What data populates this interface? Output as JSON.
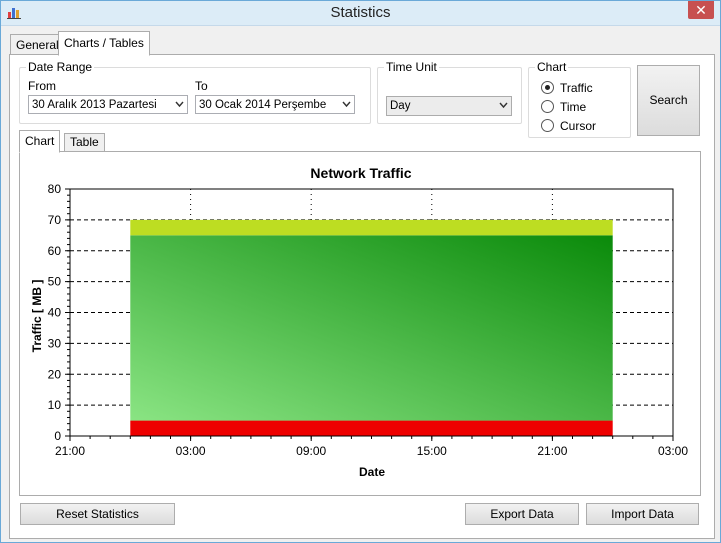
{
  "window": {
    "title": "Statistics",
    "close_glyph": "✕",
    "app_icon": "bar-chart-icon"
  },
  "outer_tabs": [
    {
      "label": "General",
      "active": false
    },
    {
      "label": "Charts / Tables",
      "active": true
    }
  ],
  "date_range": {
    "group_label": "Date Range",
    "from_label": "From",
    "from_value": "30   Aralık   2013  Pazartesi",
    "to_label": "To",
    "to_value": "30   Ocak   2014 Perşembe"
  },
  "time_unit": {
    "group_label": "Time Unit",
    "value": "Day"
  },
  "chart_options": {
    "group_label": "Chart",
    "options": [
      {
        "label": "Traffic",
        "checked": true
      },
      {
        "label": "Time",
        "checked": false
      },
      {
        "label": "Cursor",
        "checked": false
      }
    ]
  },
  "search_button": "Search",
  "inner_tabs": [
    {
      "label": "Chart",
      "active": true
    },
    {
      "label": "Table",
      "active": false
    }
  ],
  "chart_data": {
    "type": "area",
    "title": "Network Traffic",
    "xlabel": "Date",
    "ylabel": "Traffic [ MB ]",
    "ylim": [
      0,
      80
    ],
    "yticks": [
      0,
      10,
      20,
      30,
      40,
      50,
      60,
      70,
      80
    ],
    "xtick_labels": [
      "21:00",
      "03:00",
      "09:00",
      "15:00",
      "21:00",
      "03:00"
    ],
    "xlim_hours": [
      0,
      30
    ],
    "bar_span_hours": [
      3,
      27
    ],
    "grid": true,
    "stacked_series": [
      {
        "from": 0,
        "to": 5,
        "color": "#ee0000"
      },
      {
        "from": 5,
        "to": 65,
        "color_light": "#88e080",
        "color_dark": "#128a12"
      },
      {
        "from": 65,
        "to": 70,
        "color": "#bddd22"
      }
    ]
  },
  "bottom_buttons": {
    "reset": "Reset Statistics",
    "export": "Export Data",
    "import": "Import Data"
  }
}
